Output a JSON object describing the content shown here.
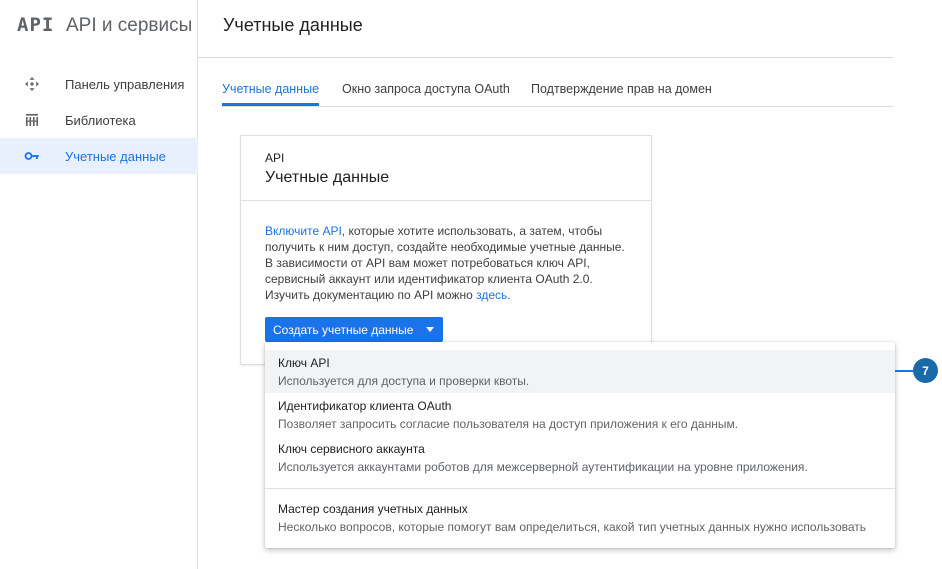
{
  "brand": {
    "logo": "API",
    "title": "API и сервисы"
  },
  "sidebar": {
    "items": [
      {
        "label": "Панель управления",
        "icon": "dashboard-icon"
      },
      {
        "label": "Библиотека",
        "icon": "library-icon"
      },
      {
        "label": "Учетные данные",
        "icon": "key-icon",
        "active": true
      }
    ]
  },
  "header": {
    "title": "Учетные данные"
  },
  "tabs": [
    {
      "label": "Учетные данные",
      "active": true
    },
    {
      "label": "Окно запроса доступа OAuth"
    },
    {
      "label": "Подтверждение прав на домен"
    }
  ],
  "card": {
    "kicker": "API",
    "title": "Учетные данные",
    "text_link1": "Включите API",
    "text_body": ", которые хотите использовать, а затем, чтобы получить к ним доступ, создайте необходимые учетные данные. В зависимости от API вам может потребоваться ключ API, сервисный аккаунт или идентификатор клиента OAuth 2.0. Изучить документацию по API можно ",
    "text_link2": "здесь",
    "text_end": ".",
    "button_label": "Создать учетные данные"
  },
  "menu": {
    "items": [
      {
        "title": "Ключ API",
        "desc": "Используется для доступа и проверки квоты."
      },
      {
        "title": "Идентификатор клиента OAuth",
        "desc": "Позволяет запросить согласие пользователя на доступ приложения к его данным."
      },
      {
        "title": "Ключ сервисного аккаунта",
        "desc": "Используется аккаунтами роботов для межсерверной аутентификации на уровне приложения."
      },
      {
        "title": "Мастер создания учетных данных",
        "desc": "Несколько вопросов, которые помогут вам определиться, какой тип учетных данных нужно использовать"
      }
    ]
  },
  "callout": {
    "number": "7"
  },
  "colors": {
    "accent": "#1a73e8",
    "badge": "#1a6aa8",
    "active_bg": "#e8f0fe"
  }
}
